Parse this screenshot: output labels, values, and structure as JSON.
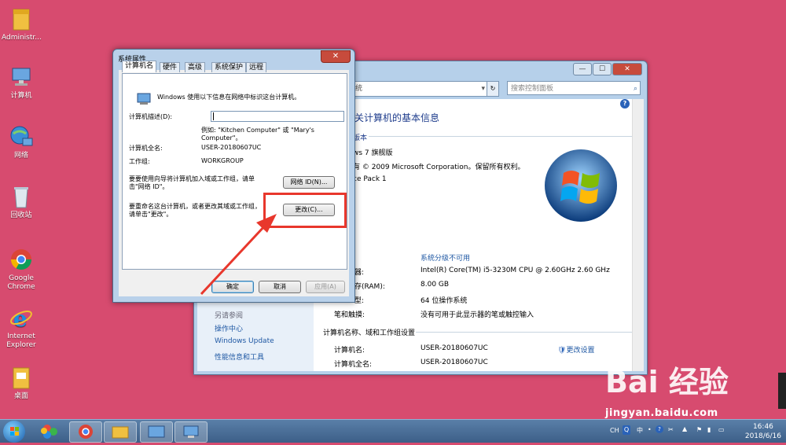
{
  "desktop": {
    "icons": [
      {
        "label": "Administr...",
        "icon": "user-folder-icon"
      },
      {
        "label": "计算机",
        "icon": "computer-icon"
      },
      {
        "label": "网络",
        "icon": "network-icon"
      },
      {
        "label": "回收站",
        "icon": "recycle-bin-icon"
      },
      {
        "label": "Google Chrome",
        "icon": "chrome-icon"
      },
      {
        "label": "Internet Explorer",
        "icon": "ie-icon"
      },
      {
        "label": "桌面",
        "icon": "desktop-folder-icon"
      }
    ]
  },
  "control_panel": {
    "search_placeholder": "搜索控制面板",
    "address_partial": "统",
    "title": "关计算机的基本信息",
    "edition_header": "版本",
    "edition": "ws 7 旗舰版",
    "copyright": "有 © 2009 Microsoft Corporation。保留所有权利。",
    "service_pack": "ce Pack 1",
    "rating_link": "系统分级不可用",
    "processor_label": "器:",
    "processor": "Intel(R) Core(TM) i5-3230M CPU @ 2.60GHz   2.60 GHz",
    "ram_label": "存(RAM):",
    "ram": "8.00 GB",
    "type_label": "型:",
    "type": "64 位操作系统",
    "pen_label": "笔和触摸:",
    "pen": "没有可用于此显示器的笔或触控输入",
    "section_name": "计算机名称、域和工作组设置",
    "computer_name_label": "计算机名:",
    "computer_name": "USER-20180607UC",
    "full_name_label": "计算机全名:",
    "full_name": "USER-20180607UC",
    "change_settings": "更改设置",
    "see_also": "另请参阅",
    "left_links": [
      "操作中心",
      "Windows Update",
      "性能信息和工具"
    ]
  },
  "dialog": {
    "title": "系统属性",
    "tabs": [
      "计算机名",
      "硬件",
      "高级",
      "系统保护",
      "远程"
    ],
    "intro": "Windows 使用以下信息在网络中标识这台计算机。",
    "desc_label": "计算机描述(D):",
    "desc_value": "",
    "example": "例如: \"Kitchen Computer\" 或 \"Mary's",
    "example2": "Computer\"。",
    "full_name_label": "计算机全名:",
    "full_name": "USER-20180607UC",
    "workgroup_label": "工作组:",
    "workgroup": "WORKGROUP",
    "network_id_text1": "要要使用向导将计算机加入域或工作组，请单",
    "network_id_text2": "击\"网络 ID\"。",
    "network_id_button": "网络 ID(N)...",
    "rename_text1": "要重命名这台计算机，或者更改其域或工作组，",
    "rename_text2": "请单击\"更改\"。",
    "change_button": "更改(C)...",
    "ok": "确定",
    "cancel": "取消",
    "apply": "应用(A)"
  },
  "taskbar": {
    "tray_lang": "CH",
    "tray_ime": "中",
    "time": "16:46",
    "date": "2018/6/16"
  },
  "watermark": {
    "brand": "Bai 经验",
    "url": "jingyan.baidu.com"
  },
  "colors": {
    "desktop": "#d74b6f",
    "highlight": "#e8372c",
    "link": "#1e57a3"
  }
}
